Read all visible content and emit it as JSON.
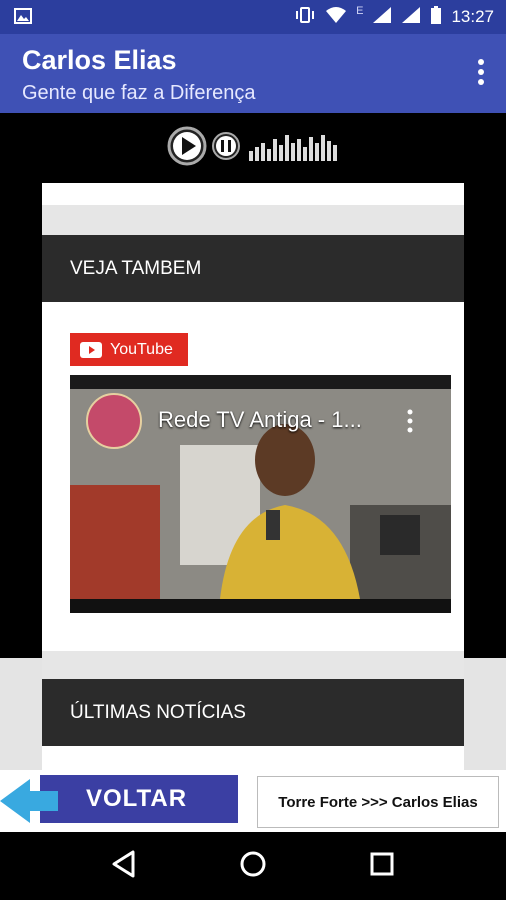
{
  "status_bar": {
    "time": "13:27",
    "network_label": "E"
  },
  "app_bar": {
    "title": "Carlos Elias",
    "subtitle": "Gente que faz a Diferença"
  },
  "sections": {
    "veja_tambem": "VEJA TAMBEM",
    "ultimas_noticias": "ÚLTIMAS NOTÍCIAS"
  },
  "youtube": {
    "badge_label": "YouTube",
    "video_title": "Rede TV Antiga - 1..."
  },
  "banner": {
    "voltar_label": "VOLTAR",
    "torre_label": "Torre Forte >>> Carlos Elias"
  },
  "colors": {
    "status_bar": "#2c3e9e",
    "app_bar": "#3f51b5",
    "section_header": "#2b2b2b",
    "youtube_red": "#e02a21",
    "voltar_blue": "#3b3fa3"
  }
}
